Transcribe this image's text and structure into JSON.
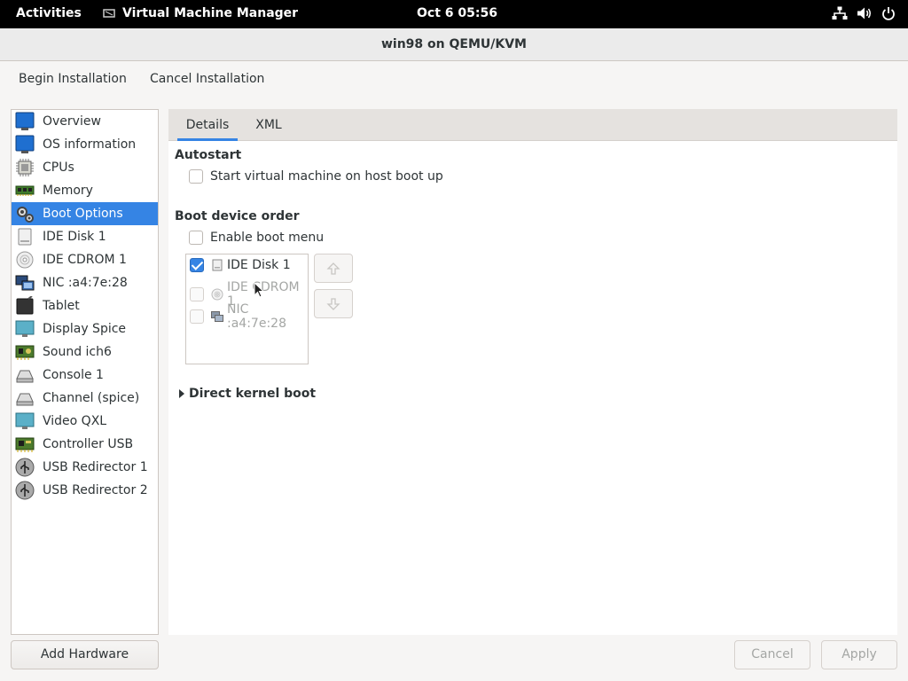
{
  "topbar": {
    "activities": "Activities",
    "app_name": "Virtual Machine Manager",
    "clock": "Oct 6  05:56",
    "tray_icons": [
      "network-icon",
      "volume-icon",
      "power-icon"
    ]
  },
  "window": {
    "title": "win98 on QEMU/KVM"
  },
  "toolbar": {
    "begin": "Begin Installation",
    "cancel": "Cancel Installation"
  },
  "sidebar": {
    "items": [
      {
        "label": "Overview",
        "icon": "monitor-icon"
      },
      {
        "label": "OS information",
        "icon": "monitor-icon"
      },
      {
        "label": "CPUs",
        "icon": "cpu-icon"
      },
      {
        "label": "Memory",
        "icon": "memory-icon"
      },
      {
        "label": "Boot Options",
        "icon": "boot-options-icon",
        "selected": true
      },
      {
        "label": "IDE Disk 1",
        "icon": "disk-icon"
      },
      {
        "label": "IDE CDROM 1",
        "icon": "cdrom-icon"
      },
      {
        "label": "NIC :a4:7e:28",
        "icon": "network-card-icon"
      },
      {
        "label": "Tablet",
        "icon": "tablet-icon"
      },
      {
        "label": "Display Spice",
        "icon": "display-icon"
      },
      {
        "label": "Sound ich6",
        "icon": "sound-card-icon"
      },
      {
        "label": "Console 1",
        "icon": "serial-console-icon"
      },
      {
        "label": "Channel (spice)",
        "icon": "channel-icon"
      },
      {
        "label": "Video QXL",
        "icon": "video-icon"
      },
      {
        "label": "Controller USB",
        "icon": "controller-icon"
      },
      {
        "label": "USB Redirector 1",
        "icon": "usb-icon"
      },
      {
        "label": "USB Redirector 2",
        "icon": "usb-icon"
      }
    ],
    "add_hardware": "Add Hardware"
  },
  "tabs": [
    {
      "label": "Details",
      "active": true
    },
    {
      "label": "XML",
      "active": false
    }
  ],
  "autostart": {
    "heading": "Autostart",
    "checkbox_label": "Start virtual machine on host boot up",
    "checked": false
  },
  "boot": {
    "heading": "Boot device order",
    "enable_menu_label": "Enable boot menu",
    "enable_menu_checked": false,
    "devices": [
      {
        "label": "IDE Disk 1",
        "checked": true,
        "enabled": true,
        "icon": "disk-icon"
      },
      {
        "label": "IDE CDROM 1",
        "checked": false,
        "enabled": false,
        "icon": "cdrom-icon"
      },
      {
        "label": "NIC :a4:7e:28",
        "checked": false,
        "enabled": false,
        "icon": "network-card-icon"
      }
    ]
  },
  "direct_kernel": {
    "label": "Direct kernel boot"
  },
  "footer": {
    "cancel": "Cancel",
    "apply": "Apply"
  },
  "colors": {
    "accent": "#3584e4",
    "topbar": "#000000",
    "disabled_text": "#a4a6a4"
  }
}
